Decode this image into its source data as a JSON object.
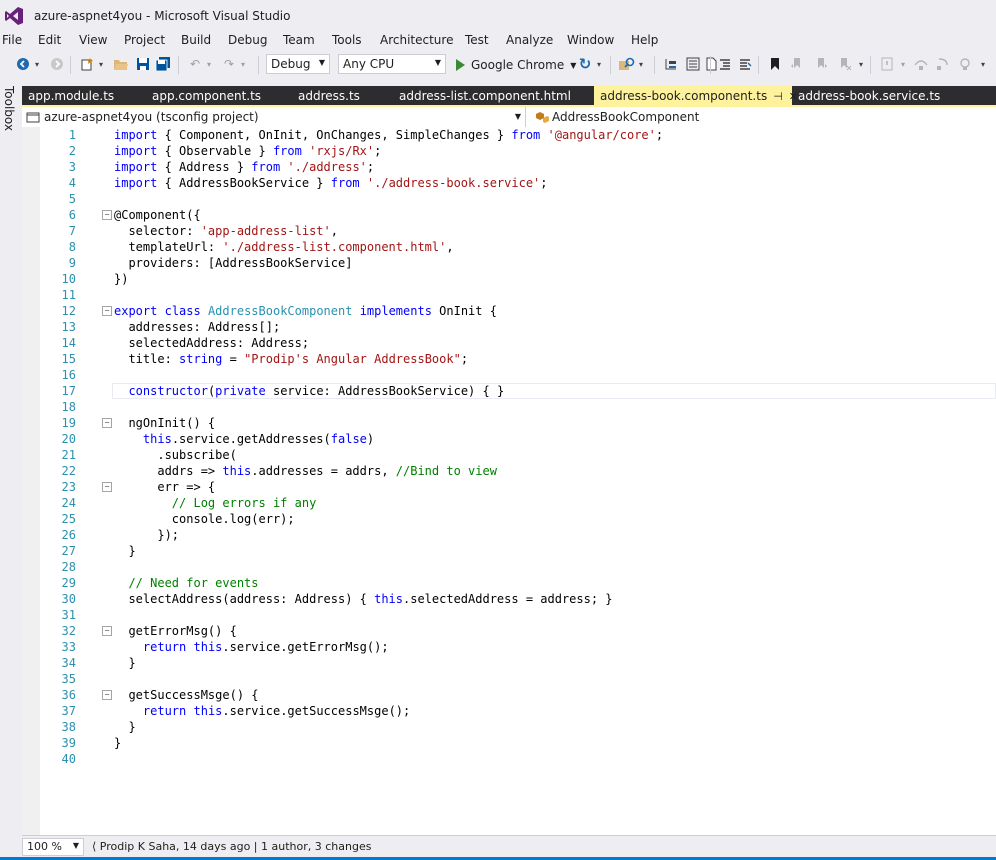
{
  "window": {
    "title": "azure-aspnet4you - Microsoft Visual Studio"
  },
  "menu": [
    "File",
    "Edit",
    "View",
    "Project",
    "Build",
    "Debug",
    "Team",
    "Tools",
    "Architecture",
    "Test",
    "Analyze",
    "Window",
    "Help"
  ],
  "toolbar": {
    "config": "Debug",
    "platform": "Any CPU",
    "run_target": "Google Chrome"
  },
  "toolbox_label": "Toolbox",
  "tabs": [
    {
      "label": "app.module.ts",
      "active": false
    },
    {
      "label": "app.component.ts",
      "active": false
    },
    {
      "label": "address.ts",
      "active": false
    },
    {
      "label": "address-list.component.html",
      "active": false
    },
    {
      "label": "address-book.component.ts",
      "active": true
    },
    {
      "label": "address-book.service.ts",
      "active": false
    }
  ],
  "nav": {
    "project": "azure-aspnet4you (tsconfig project)",
    "symbol": "AddressBookComponent"
  },
  "status": {
    "zoom": "100 %",
    "codelens": "Prodip K Saha, 14 days ago | 1 author, 3 changes"
  },
  "code": [
    "1",
    "2",
    "3",
    "4",
    "5",
    "6",
    "7",
    "8",
    "9",
    "10",
    "11",
    "12",
    "13",
    "14",
    "15",
    "16",
    "17",
    "18",
    "19",
    "20",
    "21",
    "22",
    "23",
    "24",
    "25",
    "26",
    "27",
    "28",
    "29",
    "30",
    "31",
    "32",
    "33",
    "34",
    "35",
    "36",
    "37",
    "38",
    "39",
    "40"
  ],
  "colors": {
    "keyword": "#0000ff",
    "string": "#a31515",
    "comment": "#008000",
    "type": "#2b91af",
    "active_tab": "#fff29d",
    "tab_bar": "#2d2d30",
    "accent": "#007acc"
  }
}
